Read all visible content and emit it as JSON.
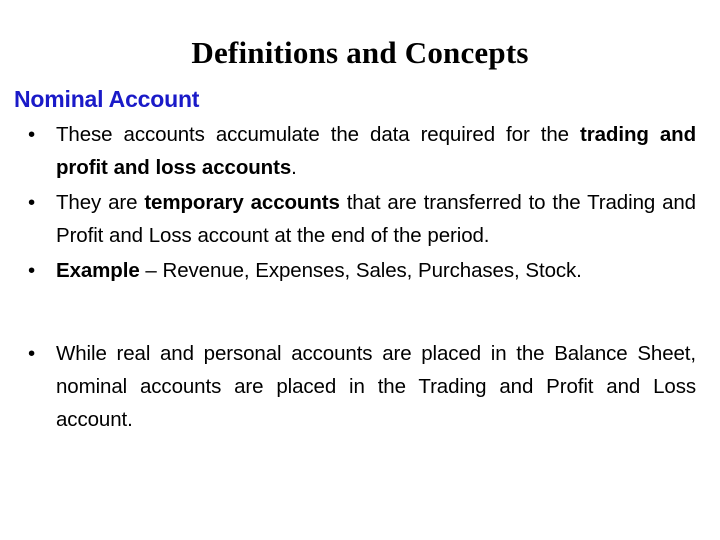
{
  "slide": {
    "title": "Definitions and Concepts",
    "subtitle": "Nominal Account",
    "subtitle_color": "#1A1AC8",
    "background_color": "#FFFFFF",
    "text_color": "#000000",
    "bullet_marker": "•",
    "bullets": [
      {
        "id": "bullet-accumulate-data",
        "segments": {
          "plain_lead": "These accounts accumulate the data required for the ",
          "bold_tail": "trading and profit and loss accounts",
          "plain_end": "."
        },
        "full_text": "These accounts accumulate the data required for the trading and profit and loss accounts."
      },
      {
        "id": "bullet-temporary-accounts",
        "segments": {
          "plain_lead": "They are ",
          "bold_mid": "temporary accounts",
          "plain_tail": " that are transferred to the Trading and Profit and Loss account at the end of the period."
        },
        "full_text": "They are temporary accounts that are transferred to the Trading and Profit and Loss account at the end of the period."
      },
      {
        "id": "bullet-example",
        "segments": {
          "bold_lead": "Example",
          "plain_tail": " – Revenue, Expenses, Sales, Purchases, Stock."
        },
        "full_text": "Example – Revenue, Expenses, Sales, Purchases, Stock."
      },
      {
        "id": "bullet-real-personal-placement",
        "segments": {
          "plain_only": "While real and personal accounts are placed in the Balance Sheet, nominal accounts are placed in the Trading and Profit and Loss account."
        },
        "full_text": "While real and personal accounts are placed in the Balance Sheet, nominal accounts are placed in the Trading and Profit and Loss account."
      }
    ]
  }
}
